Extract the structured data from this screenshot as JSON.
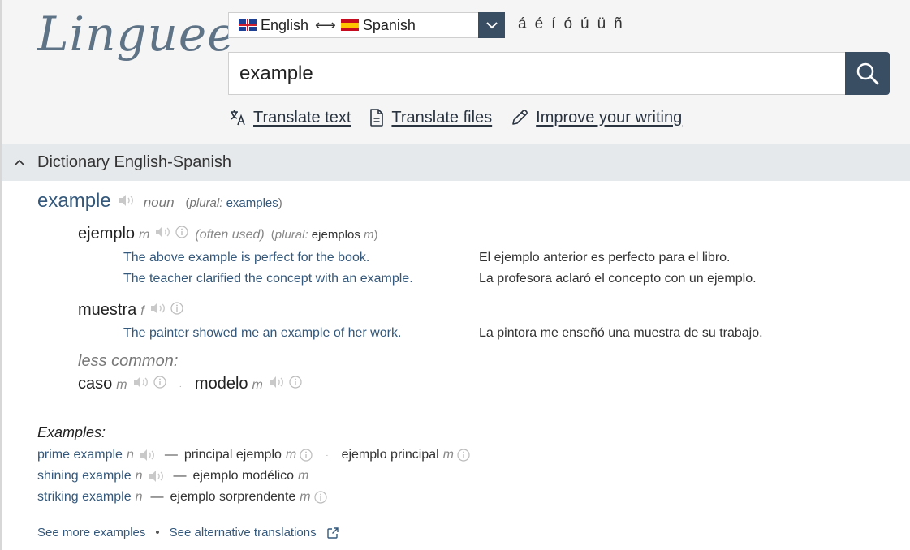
{
  "header": {
    "logo": "Linguee",
    "lang_from": "English",
    "lang_to": "Spanish",
    "accents": [
      "á",
      "é",
      "í",
      "ó",
      "ú",
      "ü",
      "ñ"
    ],
    "search_value": "example",
    "tools": {
      "translate_text": "Translate text",
      "translate_files": "Translate files",
      "improve_writing": "Improve your writing"
    }
  },
  "dictionary": {
    "title": "Dictionary English-Spanish",
    "lemma": {
      "word": "example",
      "pos": "noun",
      "plural_label": "plural:",
      "plural_word": "examples"
    },
    "translations": [
      {
        "word": "ejemplo",
        "gender": "m",
        "usage": "(often used)",
        "plural_label": "plural:",
        "plural_word": "ejemplos",
        "plural_gender": "m",
        "examples": [
          {
            "en": "The above example is perfect for the book.",
            "es": "El ejemplo anterior es perfecto para el libro."
          },
          {
            "en": "The teacher clarified the concept with an example.",
            "es": "La profesora aclaró el concepto con un ejemplo."
          }
        ]
      },
      {
        "word": "muestra",
        "gender": "f",
        "examples": [
          {
            "en": "The painter showed me an example of her work.",
            "es": "La pintora me enseñó una muestra de su trabajo."
          }
        ]
      }
    ],
    "less_common_label": "less common:",
    "less_common": [
      {
        "word": "caso",
        "gender": "m"
      },
      {
        "word": "modelo",
        "gender": "m"
      }
    ],
    "examples_heading": "Examples:",
    "example_phrases": [
      {
        "en": "prime example",
        "en_pos": "n",
        "es": "principal ejemplo",
        "es_gender": "m",
        "alt": "ejemplo principal",
        "alt_gender": "m"
      },
      {
        "en": "shining example",
        "en_pos": "n",
        "es": "ejemplo modélico",
        "es_gender": "m"
      },
      {
        "en": "striking example",
        "en_pos": "n",
        "es": "ejemplo sorprendente",
        "es_gender": "m"
      }
    ],
    "see_more": "See more examples",
    "see_alternatives": "See alternative translations"
  }
}
